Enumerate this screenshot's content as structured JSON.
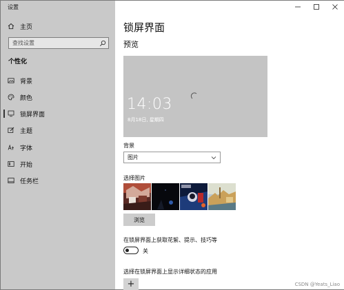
{
  "window": {
    "title": "设置"
  },
  "caption": {
    "minimize": "—",
    "maximize": "☐",
    "close": "✕"
  },
  "sidebar": {
    "home_label": "主页",
    "search_placeholder": "查找设置",
    "section_heading": "个性化",
    "items": [
      {
        "label": "背景",
        "icon": "picture-icon"
      },
      {
        "label": "颜色",
        "icon": "palette-icon"
      },
      {
        "label": "锁屏界面",
        "icon": "lock-screen-icon",
        "selected": true
      },
      {
        "label": "主题",
        "icon": "theme-icon"
      },
      {
        "label": "字体",
        "icon": "font-icon"
      },
      {
        "label": "开始",
        "icon": "start-icon"
      },
      {
        "label": "任务栏",
        "icon": "taskbar-icon"
      }
    ]
  },
  "main": {
    "page_title": "锁屏界面",
    "preview_heading": "预览",
    "preview": {
      "time": "14:03",
      "date": "8月18日, 星期四"
    },
    "background_label": "背景",
    "background_value": "图片",
    "choose_picture_label": "选择图片",
    "browse_label": "浏览",
    "fun_facts_label": "在锁屏界面上获取花絮、提示、技巧等",
    "fun_facts_state": "关",
    "detailed_status_label": "选择在锁屏界面上显示详细状态的应用",
    "add_app_label": "+"
  },
  "watermark": "CSDN @Yeats_Liao",
  "colors": {
    "sidebar_bg": "#c9c9c9",
    "preview_bg": "#c4c4c4",
    "button_bg": "#cccccc"
  }
}
